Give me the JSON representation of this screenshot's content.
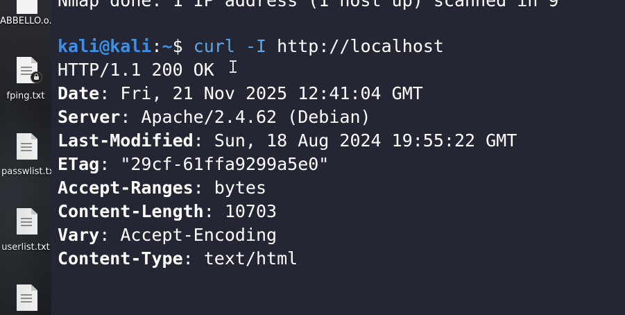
{
  "desktop": {
    "items": [
      {
        "label": "ABBELLO.o...",
        "icon": "text-file-icon"
      },
      {
        "label": "fping.txt",
        "icon": "locked-text-file-icon"
      },
      {
        "label": "passwlist.txt",
        "icon": "text-file-icon"
      },
      {
        "label": "userlist.txt",
        "icon": "text-file-icon"
      },
      {
        "label": "",
        "icon": "text-file-icon"
      }
    ]
  },
  "terminal": {
    "top_partial_line": "Nmap done: 1 IP address (1 host up) scanned in 9",
    "prompt": {
      "user_host": "kali@kali",
      "sep": ":",
      "path": "~",
      "symbol": "$ "
    },
    "command": {
      "name": "curl",
      "flag": "-I",
      "arg": "http://localhost"
    },
    "status_line": "HTTP/1.1 200 OK",
    "headers": [
      {
        "key": "Date",
        "value": "Fri, 21 Nov 2025 12:41:04 GMT"
      },
      {
        "key": "Server",
        "value": "Apache/2.4.62 (Debian)"
      },
      {
        "key": "Last-Modified",
        "value": "Sun, 18 Aug 2024 19:55:22 GMT"
      },
      {
        "key": "ETag",
        "value": "\"29cf-61ffa9299a5e0\""
      },
      {
        "key": "Accept-Ranges",
        "value": "bytes"
      },
      {
        "key": "Content-Length",
        "value": "10703"
      },
      {
        "key": "Vary",
        "value": "Accept-Encoding"
      },
      {
        "key": "Content-Type",
        "value": "text/html"
      }
    ],
    "colors": {
      "background": "#242634",
      "prompt": "#3e8fe6",
      "command": "#5fa8e8",
      "text": "#ffffff"
    }
  }
}
